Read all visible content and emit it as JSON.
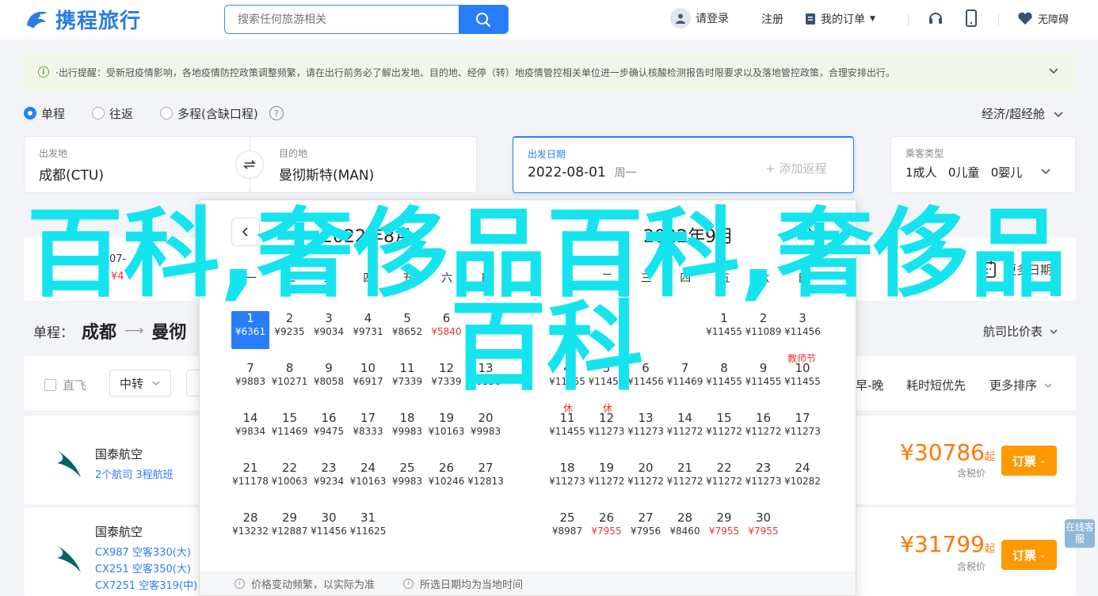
{
  "header": {
    "logo_text": "携程旅行",
    "search_placeholder": "搜索任何旅游相关",
    "login": "请登录",
    "register": "注册",
    "my_orders": "我的订单",
    "barrier_free": "无障碍"
  },
  "notice": {
    "text": "·出行提醒：受新冠疫情影响，各地疫情防控政策调整频繁，请在出行前务必了解出发地、目的地、经停（转）地疫情管控相关单位进一步确认核酸检测报告时限要求以及落地管控政策，合理安排出行。"
  },
  "trip_types": [
    "单程",
    "往返",
    "多程(含缺口程)"
  ],
  "cabin": "经济/超经舱",
  "form": {
    "from_label": "出发地",
    "from_value": "成都(CTU)",
    "to_label": "目的地",
    "to_value": "曼彻斯特(MAN)",
    "date_label": "出发日期",
    "date_value": "2022-08-01",
    "date_weekday": "周一",
    "add_return": "+ 添加返程",
    "pax_label": "乘客类型",
    "pax_value": "1成人   0儿童   0婴儿"
  },
  "results": {
    "more_dates": "更多日期",
    "route_prefix": "单程：",
    "route_from": "成都",
    "route_to": "曼彻",
    "compare": "航司比价表",
    "direct": "直飞",
    "transfer": "中转",
    "sort_early": "早-晚",
    "sort_short": "耗时短优先",
    "sort_more": "更多排序",
    "partial_date": "07-",
    "partial_price": "¥4"
  },
  "flights": [
    {
      "airline": "国泰航空",
      "sub": "2个航司   3程航班",
      "price": "¥30786",
      "price_suffix": "起",
      "tax": "含税价",
      "book": "订票"
    },
    {
      "airline": "国泰航空",
      "sub1": "CX987 空客330(大)",
      "sub2": "CX251 空客350(大)",
      "sub3": "CX7251 空客319(中)",
      "price": "¥31799",
      "price_suffix": "起",
      "tax": "含税价",
      "book": "订票"
    }
  ],
  "calendar": {
    "left_title": "2022年8月",
    "right_title": "2022年9月",
    "weekdays": [
      "一",
      "二",
      "三",
      "四",
      "五",
      "六",
      "日"
    ],
    "aug": [
      {
        "d": "1",
        "p": "¥6361",
        "sel": true
      },
      {
        "d": "2",
        "p": "¥9235"
      },
      {
        "d": "3",
        "p": "¥9034"
      },
      {
        "d": "4",
        "p": "¥9731"
      },
      {
        "d": "5",
        "p": "¥8652"
      },
      {
        "d": "6",
        "p": "¥5840",
        "low": true
      },
      {
        "d": "",
        "p": ""
      },
      {
        "d": "7",
        "p": "¥9883"
      },
      {
        "d": "8",
        "p": "¥10271"
      },
      {
        "d": "9",
        "p": "¥8058"
      },
      {
        "d": "10",
        "p": "¥6917"
      },
      {
        "d": "11",
        "p": "¥7339"
      },
      {
        "d": "12",
        "p": "¥7339"
      },
      {
        "d": "13",
        "p": "¥9556"
      },
      {
        "d": "14",
        "p": "¥9834"
      },
      {
        "d": "15",
        "p": "¥11469"
      },
      {
        "d": "16",
        "p": "¥9475"
      },
      {
        "d": "17",
        "p": "¥8333"
      },
      {
        "d": "18",
        "p": "¥9983"
      },
      {
        "d": "19",
        "p": "¥10163"
      },
      {
        "d": "20",
        "p": "¥9983"
      },
      {
        "d": "21",
        "p": "¥11178"
      },
      {
        "d": "22",
        "p": "¥10063"
      },
      {
        "d": "23",
        "p": "¥9234"
      },
      {
        "d": "24",
        "p": "¥10163"
      },
      {
        "d": "25",
        "p": "¥9983"
      },
      {
        "d": "26",
        "p": "¥10246"
      },
      {
        "d": "27",
        "p": "¥12813"
      },
      {
        "d": "28",
        "p": "¥13232"
      },
      {
        "d": "29",
        "p": "¥12887"
      },
      {
        "d": "30",
        "p": "¥11456"
      },
      {
        "d": "31",
        "p": "¥11625"
      }
    ],
    "sep": [
      {
        "d": "",
        "p": ""
      },
      {
        "d": "",
        "p": ""
      },
      {
        "d": "",
        "p": ""
      },
      {
        "d": "",
        "p": ""
      },
      {
        "d": "1",
        "p": "¥11455"
      },
      {
        "d": "2",
        "p": "¥11089"
      },
      {
        "d": "3",
        "p": "¥11456"
      },
      {
        "d": "4",
        "p": "¥11455"
      },
      {
        "d": "5",
        "p": "¥11455"
      },
      {
        "d": "6",
        "p": "¥11456"
      },
      {
        "d": "7",
        "p": "¥11469"
      },
      {
        "d": "8",
        "p": "¥11455"
      },
      {
        "d": "9",
        "p": "¥11455"
      },
      {
        "d": "10",
        "p": "¥11455"
      },
      {
        "d": "11",
        "p": "¥11455"
      },
      {
        "d": "12",
        "p": "¥11273"
      },
      {
        "d": "13",
        "p": "¥11273"
      },
      {
        "d": "14",
        "p": "¥11272"
      },
      {
        "d": "15",
        "p": "¥11272"
      },
      {
        "d": "16",
        "p": "¥11272"
      },
      {
        "d": "17",
        "p": "¥11273"
      },
      {
        "d": "18",
        "p": "¥11273"
      },
      {
        "d": "19",
        "p": "¥11272"
      },
      {
        "d": "20",
        "p": "¥11272"
      },
      {
        "d": "21",
        "p": "¥11272"
      },
      {
        "d": "22",
        "p": "¥11272"
      },
      {
        "d": "23",
        "p": "¥11273"
      },
      {
        "d": "24",
        "p": "¥10282"
      },
      {
        "d": "25",
        "p": "¥8987"
      },
      {
        "d": "26",
        "p": "¥7955",
        "low": true
      },
      {
        "d": "27",
        "p": "¥7956"
      },
      {
        "d": "28",
        "p": "¥8460"
      },
      {
        "d": "29",
        "p": "¥7955",
        "low": true
      },
      {
        "d": "30",
        "p": "¥7955",
        "low": true
      }
    ],
    "teachers_day": "教师节",
    "rest": "休",
    "foot1": "价格变动频繁，以实际为准",
    "foot2": "所选日期均为当地时间"
  },
  "watermark": "百科,奢侈品百科,奢侈品百科",
  "side_tab": "在线客服",
  "colors": {
    "brand": "#287dfa",
    "price": "#ff7700",
    "book": "#ff9900",
    "watermark": "#15e4ef"
  }
}
